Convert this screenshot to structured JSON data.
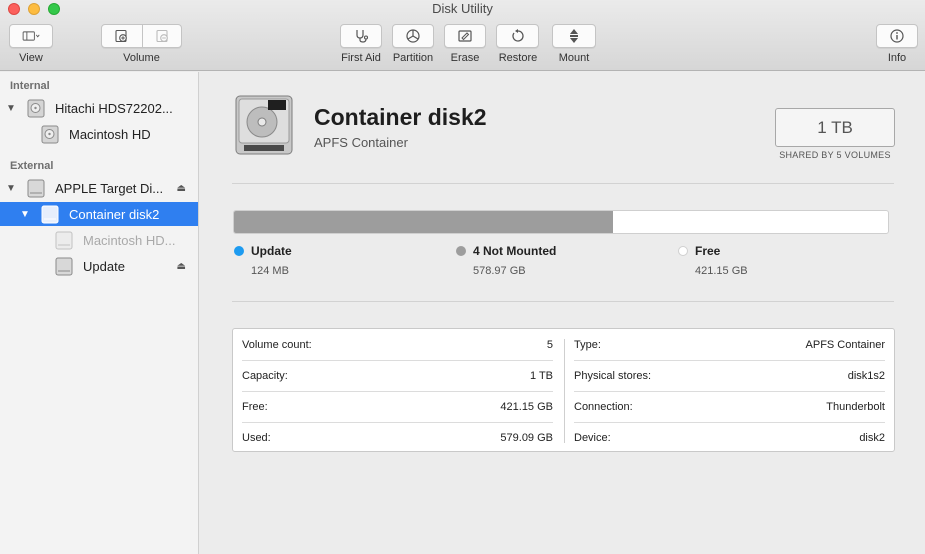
{
  "window": {
    "title": "Disk Utility"
  },
  "toolbar": {
    "view": "View",
    "volume": "Volume",
    "first_aid": "First Aid",
    "partition": "Partition",
    "erase": "Erase",
    "restore": "Restore",
    "mount": "Mount",
    "info": "Info"
  },
  "sidebar": {
    "internal_heading": "Internal",
    "external_heading": "External",
    "items": [
      {
        "label": "Hitachi HDS72202..."
      },
      {
        "label": "Macintosh HD"
      },
      {
        "label": "APPLE Target Di..."
      },
      {
        "label": "Container disk2"
      },
      {
        "label": "Macintosh HD..."
      },
      {
        "label": "Update"
      }
    ]
  },
  "main": {
    "title": "Container disk2",
    "subtitle": "APFS Container",
    "capacity": "1 TB",
    "shared_label": "SHARED BY 5 VOLUMES",
    "usage_fraction": 0.58,
    "legend": [
      {
        "name": "Update",
        "size": "124 MB",
        "color": "#1d9bf0"
      },
      {
        "name": "4 Not Mounted",
        "size": "578.97 GB",
        "color": "#9d9d9d"
      },
      {
        "name": "Free",
        "size": "421.15 GB",
        "color": "#ffffff"
      }
    ],
    "info_left": [
      {
        "key": "Volume count:",
        "value": "5"
      },
      {
        "key": "Capacity:",
        "value": "1 TB"
      },
      {
        "key": "Free:",
        "value": "421.15 GB"
      },
      {
        "key": "Used:",
        "value": "579.09 GB"
      }
    ],
    "info_right": [
      {
        "key": "Type:",
        "value": "APFS Container"
      },
      {
        "key": "Physical stores:",
        "value": "disk1s2"
      },
      {
        "key": "Connection:",
        "value": "Thunderbolt"
      },
      {
        "key": "Device:",
        "value": "disk2"
      }
    ]
  }
}
